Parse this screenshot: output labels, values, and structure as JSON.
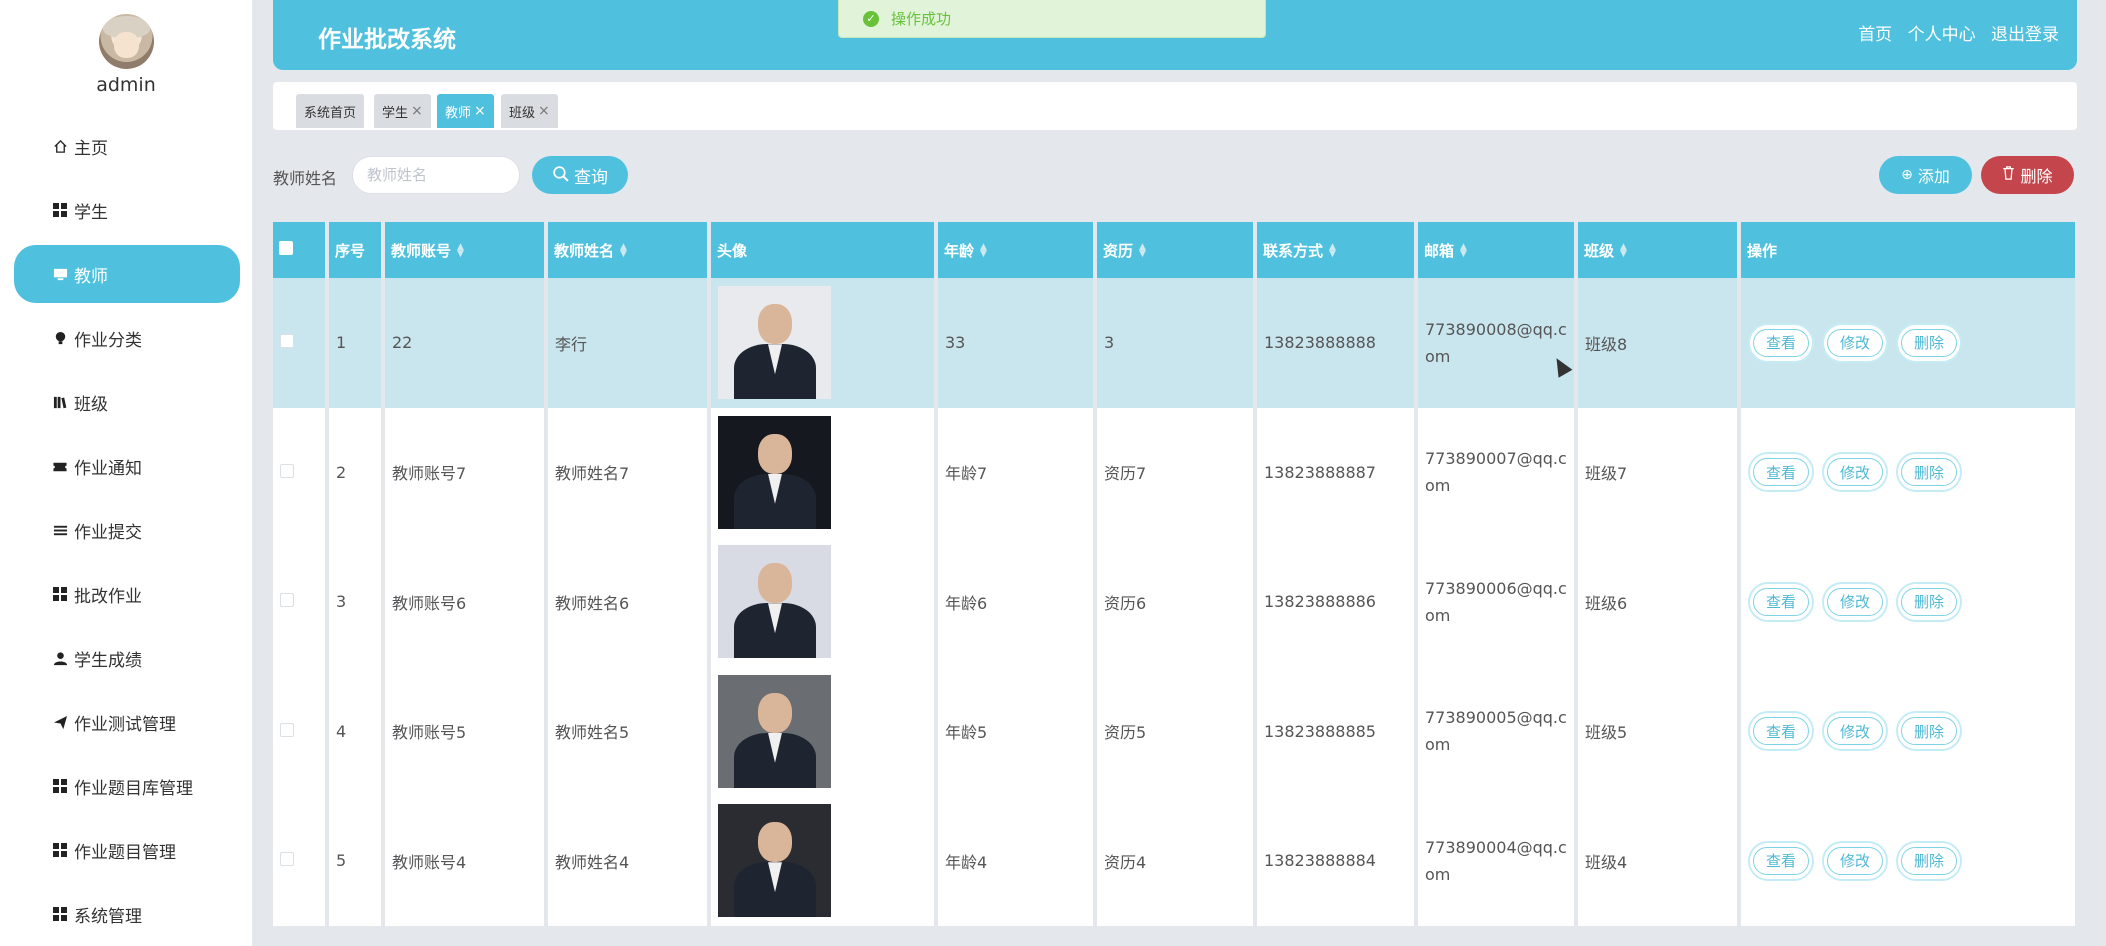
{
  "sidebar": {
    "username": "admin",
    "items": [
      {
        "label": "主页",
        "icon": "home-icon"
      },
      {
        "label": "学生",
        "icon": "grid-icon"
      },
      {
        "label": "教师",
        "icon": "monitor-icon",
        "active": true
      },
      {
        "label": "作业分类",
        "icon": "bulb-icon"
      },
      {
        "label": "班级",
        "icon": "book-icon"
      },
      {
        "label": "作业通知",
        "icon": "ticket-icon"
      },
      {
        "label": "作业提交",
        "icon": "list-icon"
      },
      {
        "label": "批改作业",
        "icon": "grid-icon"
      },
      {
        "label": "学生成绩",
        "icon": "user-icon"
      },
      {
        "label": "作业测试管理",
        "icon": "send-icon"
      },
      {
        "label": "作业题目库管理",
        "icon": "grid-icon"
      },
      {
        "label": "作业题目管理",
        "icon": "grid-icon"
      },
      {
        "label": "系统管理",
        "icon": "grid-icon"
      }
    ]
  },
  "header": {
    "title": "作业批改系统",
    "links": [
      "首页",
      "个人中心",
      "退出登录"
    ]
  },
  "toast": {
    "message": "操作成功"
  },
  "tabs": [
    {
      "label": "系统首页",
      "closable": false
    },
    {
      "label": "学生",
      "closable": true
    },
    {
      "label": "教师",
      "closable": true,
      "active": true
    },
    {
      "label": "班级",
      "closable": true
    }
  ],
  "search": {
    "label": "教师姓名",
    "placeholder": "教师姓名",
    "value": "",
    "query_button": "查询",
    "add_button": "添加",
    "delete_button": "删除"
  },
  "table": {
    "columns": [
      "序号",
      "教师账号",
      "教师姓名",
      "头像",
      "年龄",
      "资历",
      "联系方式",
      "邮箱",
      "班级",
      "操作"
    ],
    "rows": [
      {
        "no": "1",
        "account": "22",
        "name": "李行",
        "age": "33",
        "seniority": "3",
        "phone": "13823888888",
        "email": "773890008@qq.com",
        "class": "班级8"
      },
      {
        "no": "2",
        "account": "教师账号7",
        "name": "教师姓名7",
        "age": "年龄7",
        "seniority": "资历7",
        "phone": "13823888887",
        "email": "773890007@qq.com",
        "class": "班级7"
      },
      {
        "no": "3",
        "account": "教师账号6",
        "name": "教师姓名6",
        "age": "年龄6",
        "seniority": "资历6",
        "phone": "13823888886",
        "email": "773890006@qq.com",
        "class": "班级6"
      },
      {
        "no": "4",
        "account": "教师账号5",
        "name": "教师姓名5",
        "age": "年龄5",
        "seniority": "资历5",
        "phone": "13823888885",
        "email": "773890005@qq.com",
        "class": "班级5"
      },
      {
        "no": "5",
        "account": "教师账号4",
        "name": "教师姓名4",
        "age": "年龄4",
        "seniority": "资历4",
        "phone": "13823888884",
        "email": "773890004@qq.com",
        "class": "班级4"
      }
    ],
    "actions": [
      "查看",
      "修改",
      "删除"
    ]
  },
  "colors": {
    "accent": "#4fc1de",
    "danger": "#c4464c",
    "row_highlight": "#c9e6ef",
    "toast_text": "#67c23a"
  }
}
